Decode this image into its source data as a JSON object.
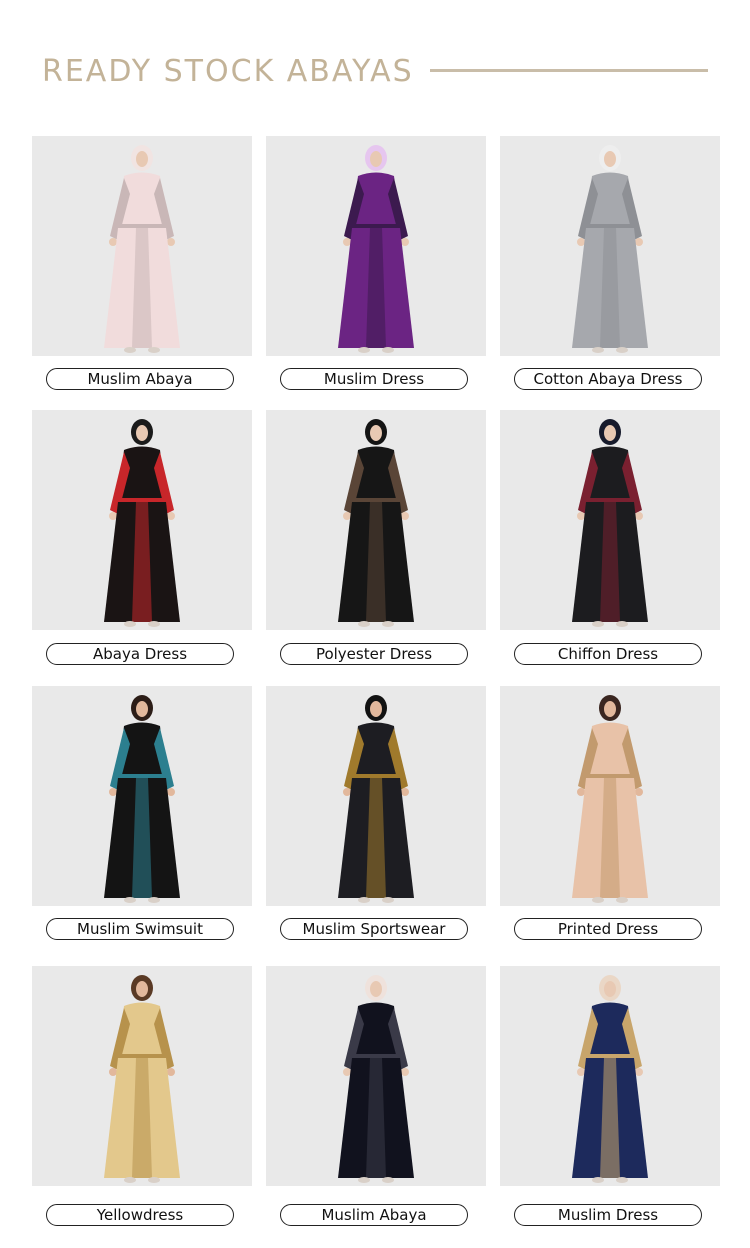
{
  "header": {
    "title": "READY STOCK ABAYAS"
  },
  "products": [
    {
      "label": "Muslim Abaya",
      "colors": {
        "skin": "#e8c9b3",
        "hijab": "#f1e4e2",
        "dress": "#f1dcdc",
        "accent": "#c9b7b7"
      }
    },
    {
      "label": "Muslim Dress",
      "colors": {
        "skin": "#e8c9b3",
        "hijab": "#e6c6ef",
        "dress": "#6b2483",
        "accent": "#3c1a4f"
      }
    },
    {
      "label": "Cotton Abaya Dress",
      "colors": {
        "skin": "#e8c9b3",
        "hijab": "#eeeeee",
        "dress": "#a6a8ad",
        "accent": "#8e9095"
      }
    },
    {
      "label": "Abaya Dress",
      "colors": {
        "skin": "#e8c9b3",
        "hijab": "#1b1b1b",
        "dress": "#1a1414",
        "accent": "#c8262a"
      }
    },
    {
      "label": "Polyester Dress",
      "colors": {
        "skin": "#e8c9b3",
        "hijab": "#141414",
        "dress": "#161616",
        "accent": "#5a4537"
      }
    },
    {
      "label": "Chiffon Dress",
      "colors": {
        "skin": "#e8c9b3",
        "hijab": "#171b2c",
        "dress": "#1c1c1f",
        "accent": "#7a2030"
      }
    },
    {
      "label": "Muslim Swimsuit",
      "colors": {
        "skin": "#e2b89c",
        "hijab": "#2c1d17",
        "dress": "#141414",
        "accent": "#2c7f8f"
      }
    },
    {
      "label": "Muslim Sportswear",
      "colors": {
        "skin": "#e2b89c",
        "hijab": "#121212",
        "dress": "#1d1d22",
        "accent": "#a07a2c"
      }
    },
    {
      "label": "Printed Dress",
      "colors": {
        "skin": "#e2b89c",
        "hijab": "#3a2620",
        "dress": "#e8c2a8",
        "accent": "#c29a6e"
      }
    },
    {
      "label": "Yellowdress",
      "colors": {
        "skin": "#e2b89c",
        "hijab": "#5a3a25",
        "dress": "#e3c88c",
        "accent": "#b7924c"
      }
    },
    {
      "label": "Muslim Abaya",
      "colors": {
        "skin": "#e8c9b3",
        "hijab": "#efe2dc",
        "dress": "#11121e",
        "accent": "#3a3a48"
      }
    },
    {
      "label": "Muslim Dress",
      "colors": {
        "skin": "#e8c9b3",
        "hijab": "#ead7c6",
        "dress": "#1d2a5c",
        "accent": "#c8a56b"
      }
    }
  ]
}
